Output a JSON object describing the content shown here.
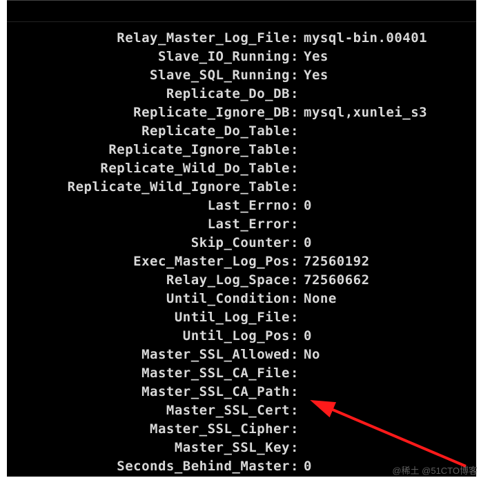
{
  "status": {
    "rows": [
      {
        "key": "Relay_Master_Log_File",
        "value": "mysql-bin.00401"
      },
      {
        "key": "Slave_IO_Running",
        "value": "Yes"
      },
      {
        "key": "Slave_SQL_Running",
        "value": "Yes"
      },
      {
        "key": "Replicate_Do_DB",
        "value": ""
      },
      {
        "key": "Replicate_Ignore_DB",
        "value": "mysql,xunlei_s3"
      },
      {
        "key": "Replicate_Do_Table",
        "value": ""
      },
      {
        "key": "Replicate_Ignore_Table",
        "value": ""
      },
      {
        "key": "Replicate_Wild_Do_Table",
        "value": ""
      },
      {
        "key": "Replicate_Wild_Ignore_Table",
        "value": ""
      },
      {
        "key": "Last_Errno",
        "value": "0"
      },
      {
        "key": "Last_Error",
        "value": ""
      },
      {
        "key": "Skip_Counter",
        "value": "0"
      },
      {
        "key": "Exec_Master_Log_Pos",
        "value": "72560192"
      },
      {
        "key": "Relay_Log_Space",
        "value": "72560662"
      },
      {
        "key": "Until_Condition",
        "value": "None"
      },
      {
        "key": "Until_Log_File",
        "value": ""
      },
      {
        "key": "Until_Log_Pos",
        "value": "0"
      },
      {
        "key": "Master_SSL_Allowed",
        "value": "No"
      },
      {
        "key": "Master_SSL_CA_File",
        "value": ""
      },
      {
        "key": "Master_SSL_CA_Path",
        "value": ""
      },
      {
        "key": "Master_SSL_Cert",
        "value": ""
      },
      {
        "key": "Master_SSL_Cipher",
        "value": ""
      },
      {
        "key": "Master_SSL_Key",
        "value": ""
      },
      {
        "key": "Seconds_Behind_Master",
        "value": "0"
      }
    ]
  },
  "colon": ":",
  "watermark": "@稀土 @51CTO博客"
}
